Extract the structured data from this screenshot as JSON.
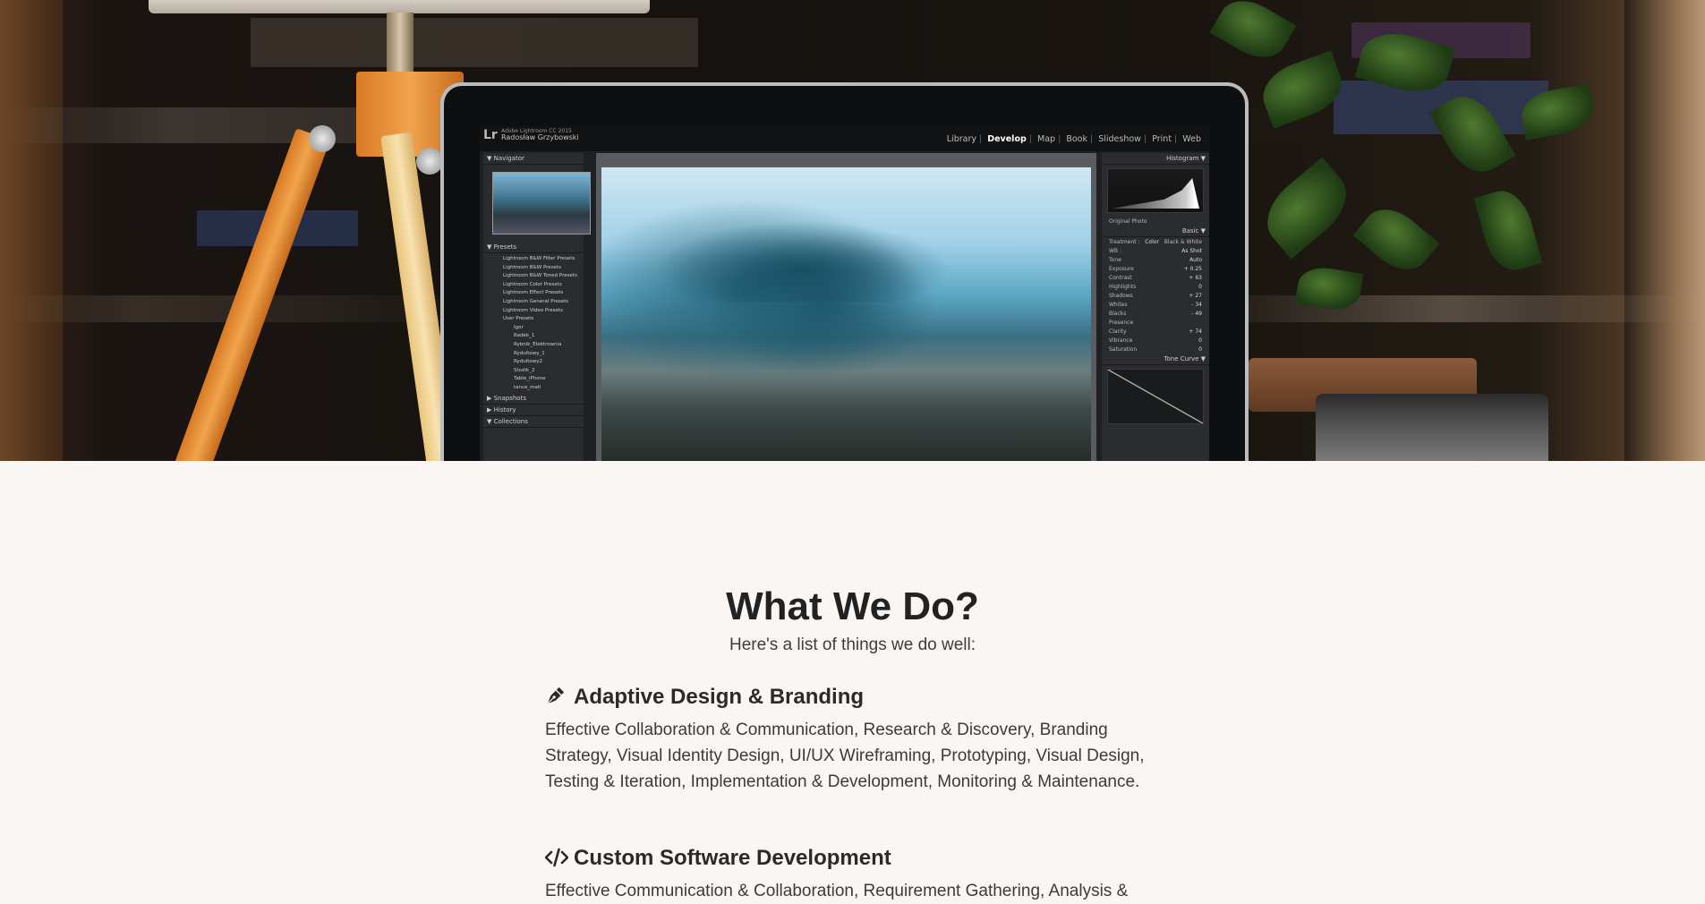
{
  "hero": {
    "image_alt": "Laptop displaying Adobe Lightroom photo editor on a desk with a lamp and plant",
    "lightroom": {
      "logo": "Lr",
      "app_name": "Adobe Lightroom CC 2015",
      "user_name": "Radosław Grzybowski",
      "modules": [
        "Library",
        "Develop",
        "Map",
        "Book",
        "Slideshow",
        "Print",
        "Web"
      ],
      "active_module": "Develop",
      "left_panels": {
        "navigator": "Navigator",
        "presets": "Presets",
        "snapshots": "Snapshots",
        "history": "History",
        "collections": "Collections"
      },
      "preset_items": [
        "Lightroom B&W Filter Presets",
        "Lightroom B&W Presets",
        "Lightroom B&W Toned Presets",
        "Lightroom Color Presets",
        "Lightroom Effect Presets",
        "Lightroom General Presets",
        "Lightroom Video Presets",
        "User Presets"
      ],
      "user_preset_items": [
        "Igor",
        "Radek_1",
        "Rybnik_Elektrownia",
        "Rydultowy_1",
        "Rydultowy2",
        "Stodik_2",
        "Table_iPhone",
        "tance_mati"
      ],
      "right_panels": {
        "histogram": "Histogram",
        "original_photo": "Original Photo",
        "basic": "Basic",
        "treatment": "Treatment :",
        "color": "Color",
        "bw": "Black & White",
        "wb": "WB :",
        "wb_value": "As Shot",
        "tone": "Tone",
        "tone_auto": "Auto",
        "presence": "Presence",
        "tone_curve": "Tone Curve"
      },
      "adjustments": [
        {
          "label": "Exposure",
          "value": "+ 0.25"
        },
        {
          "label": "Contrast",
          "value": "+ 63"
        },
        {
          "label": "Highlights",
          "value": "0"
        },
        {
          "label": "Shadows",
          "value": "+ 27"
        },
        {
          "label": "Whites",
          "value": "- 34"
        },
        {
          "label": "Blacks",
          "value": "- 49"
        }
      ],
      "presence_adjustments": [
        {
          "label": "Clarity",
          "value": "+ 74"
        },
        {
          "label": "Vibrance",
          "value": "0"
        },
        {
          "label": "Saturation",
          "value": "0"
        }
      ]
    }
  },
  "section": {
    "title": "What We Do?",
    "subtitle": "Here's a list of things we do well:"
  },
  "services": [
    {
      "icon": "pen-nib-icon",
      "title": "Adaptive Design & Branding",
      "description": "Effective Collaboration & Communication, Research & Discovery, Branding Strategy, Visual Identity Design, UI/UX Wireframing, Prototyping, Visual Design, Testing & Iteration, Implementation & Development, Monitoring & Maintenance."
    },
    {
      "icon": "code-icon",
      "title": "Custom Software Development",
      "description": "Effective Communication & Collaboration, Requirement Gathering, Analysis &"
    }
  ],
  "colors": {
    "page_background": "#f9f6f3",
    "heading": "#222222",
    "body_text": "#3b3b3b"
  }
}
